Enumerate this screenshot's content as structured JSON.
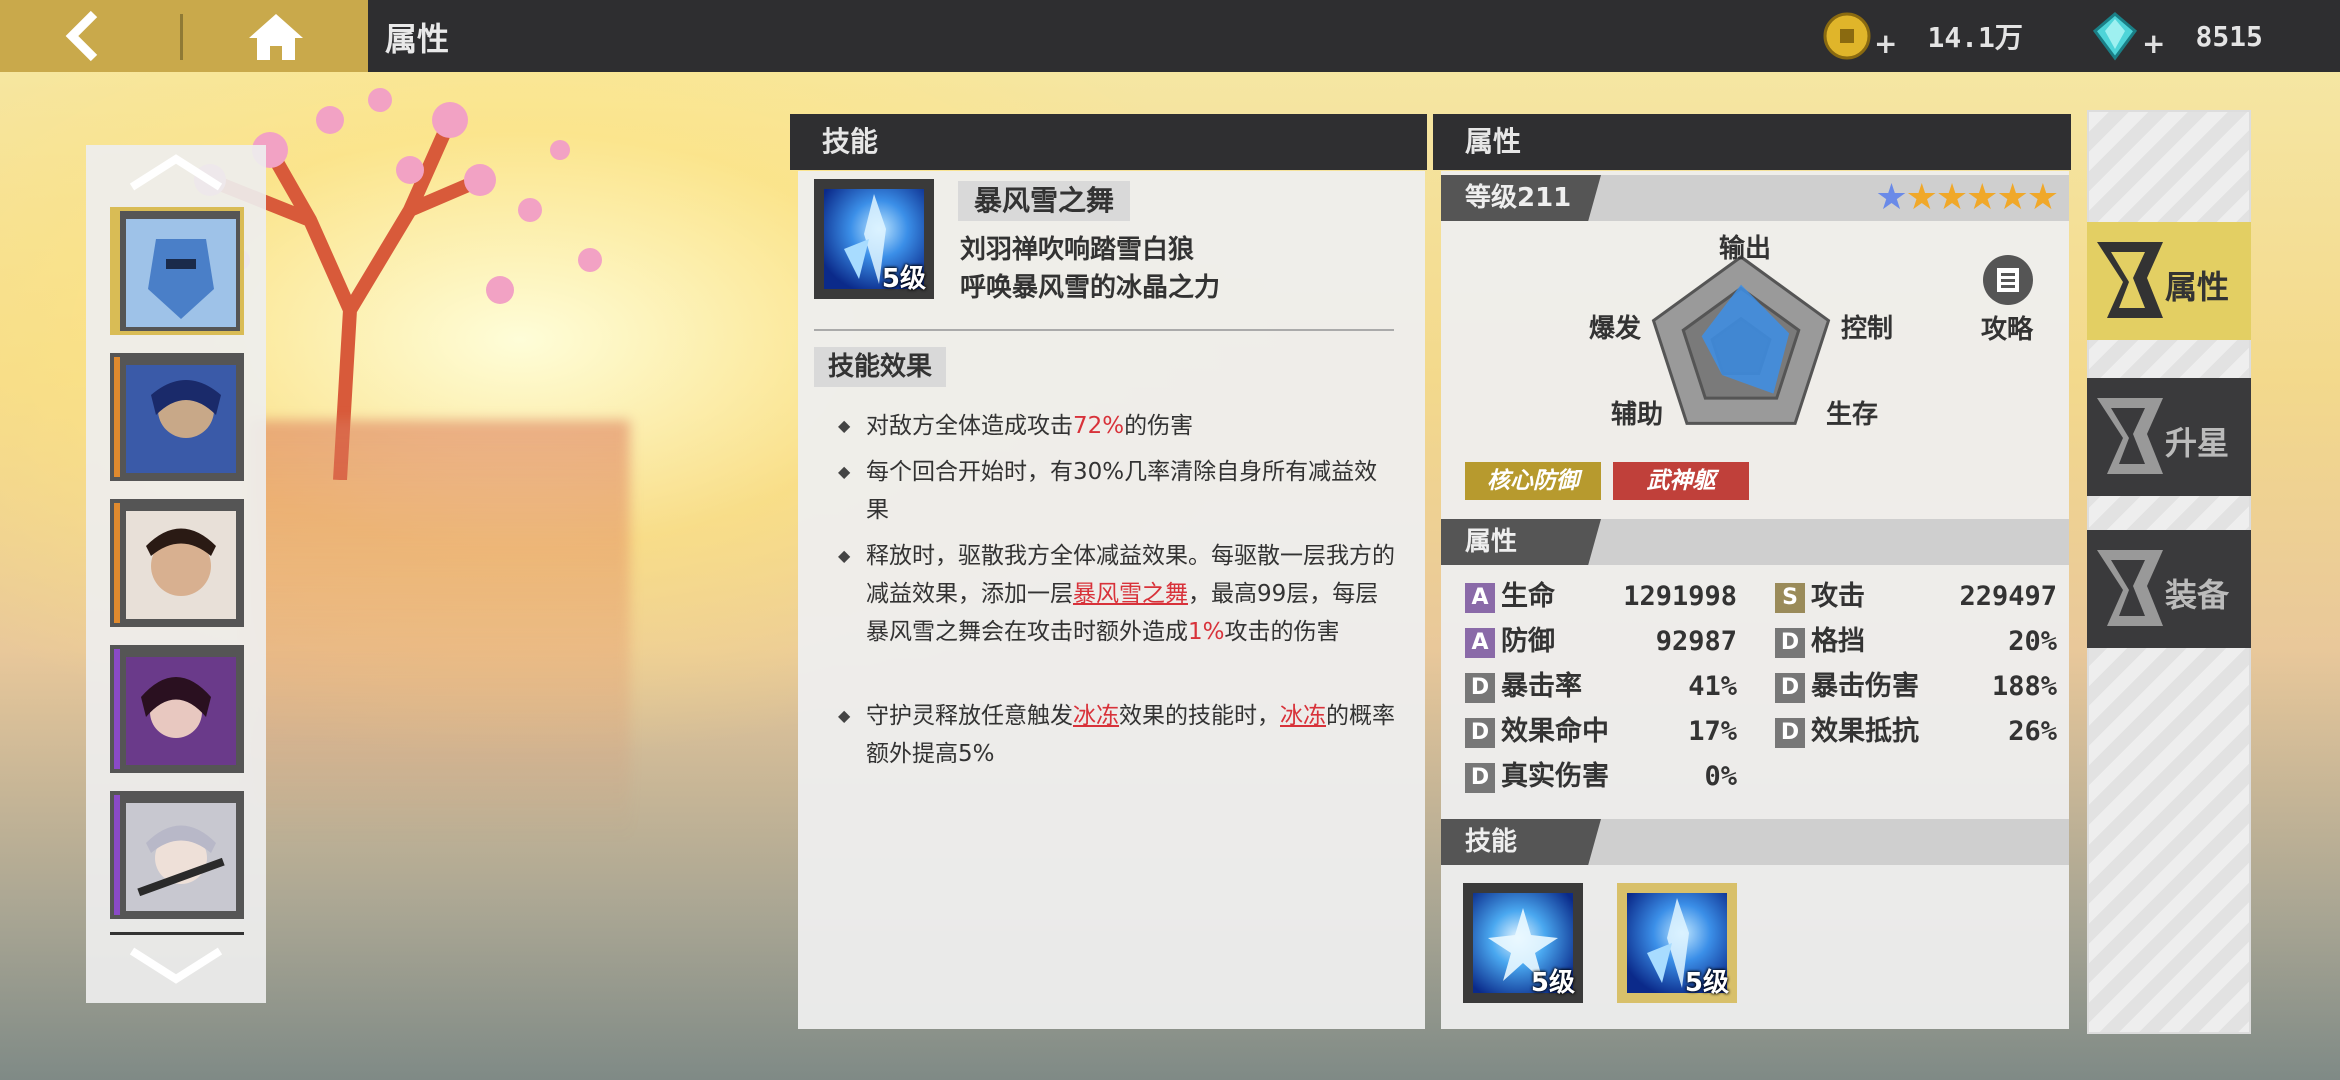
{
  "topbar": {
    "title": "属性",
    "gold_value": "14.1万",
    "gem_value": "8515",
    "plus": "+"
  },
  "heroes": [
    {
      "selected": true,
      "rarity_color": "#d9bc55",
      "tone": "#4a7fc8"
    },
    {
      "selected": false,
      "rarity_color": "#e08a2e",
      "tone": "#2a4a9a"
    },
    {
      "selected": false,
      "rarity_color": "#e08a2e",
      "tone": "#5a4438"
    },
    {
      "selected": false,
      "rarity_color": "#8a4ac8",
      "tone": "#4a2a5a"
    },
    {
      "selected": false,
      "rarity_color": "#8a4ac8",
      "tone": "#9a9aa8"
    }
  ],
  "skill_panel": {
    "header": "技能",
    "skill_name": "暴风雪之舞",
    "skill_level": "5级",
    "desc_line1": "刘羽禅吹响踏雪白狼",
    "desc_line2": "呼唤暴风雪的冰晶之力",
    "effect_title": "技能效果",
    "effects": {
      "e1_a": "对敌方全体造成攻击",
      "e1_hl": "72%",
      "e1_b": "的伤害",
      "e2": "每个回合开始时，有30%几率清除自身所有减益效果",
      "e3_a": "释放时，驱散我方全体减益效果。每驱散一层我方的减益效果，添加一层",
      "e3_ul": "暴风雪之舞",
      "e3_b": "，最高99层，每层暴风雪之舞会在攻击时额外造成",
      "e3_hl": "1%",
      "e3_c": "攻击的伤害",
      "e4_a": "守护灵释放任意触发",
      "e4_ul1": "冰冻",
      "e4_b": "效果的技能时，",
      "e4_ul2": "冰冻",
      "e4_c": "的概率额外提高5%"
    }
  },
  "attr_panel": {
    "header": "属性",
    "level": "等级211",
    "stars": 6,
    "radar": {
      "top": "输出",
      "right": "控制",
      "bottom_right": "生存",
      "bottom_left": "辅助",
      "left": "爆发"
    },
    "radar_values": [
      0.7,
      0.55,
      0.6,
      0.35,
      0.45
    ],
    "strategy": "攻略",
    "badges": [
      "核心防御",
      "武神躯"
    ],
    "stats_title": "属性",
    "stats": [
      {
        "grade": "A",
        "name": "生命",
        "value": "1291998"
      },
      {
        "grade": "S",
        "name": "攻击",
        "value": "229497"
      },
      {
        "grade": "A",
        "name": "防御",
        "value": "92987"
      },
      {
        "grade": "D",
        "name": "格挡",
        "value": "20%"
      },
      {
        "grade": "D",
        "name": "暴击率",
        "value": "41%"
      },
      {
        "grade": "D",
        "name": "暴击伤害",
        "value": "188%"
      },
      {
        "grade": "D",
        "name": "效果命中",
        "value": "17%"
      },
      {
        "grade": "D",
        "name": "效果抵抗",
        "value": "26%"
      },
      {
        "grade": "D",
        "name": "真实伤害",
        "value": "0%"
      }
    ],
    "skills_title": "技能",
    "skill_levels": [
      "5级",
      "5级"
    ]
  },
  "side_tabs": [
    {
      "label": "属性",
      "active": true
    },
    {
      "label": "升星",
      "active": false
    },
    {
      "label": "装备",
      "active": false
    }
  ],
  "colors": {
    "gold": "#c9a94b",
    "dark": "#2e2e30",
    "accent_red": "#d8323a",
    "badge1": "#b79a2e",
    "badge2": "#c0403a"
  }
}
